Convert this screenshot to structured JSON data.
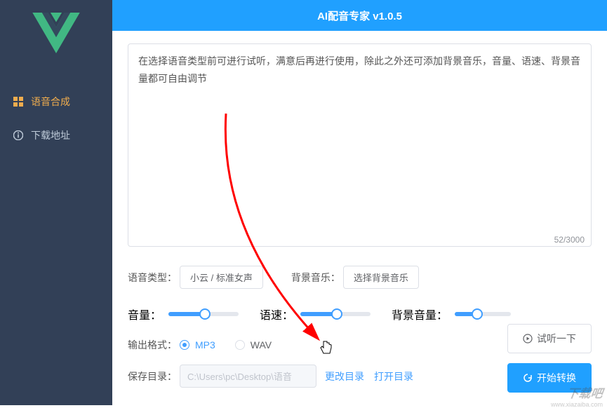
{
  "app": {
    "title": "AI配音专家 v1.0.5"
  },
  "sidebar": {
    "items": [
      {
        "label": "语音合成"
      },
      {
        "label": "下载地址"
      }
    ]
  },
  "textarea": {
    "value": "在选择语音类型前可进行试听，满意后再进行使用，除此之外还可添加背景音乐，音量、语速、背景音量都可自由调节",
    "count": "52/3000"
  },
  "voiceType": {
    "label": "语音类型：",
    "value": "小云 / 标准女声"
  },
  "bgMusic": {
    "label": "背景音乐：",
    "value": "选择背景音乐"
  },
  "sliders": {
    "volume": {
      "label": "音量：",
      "pct": 52
    },
    "speed": {
      "label": "语速：",
      "pct": 52
    },
    "bgVolume": {
      "label": "背景音量：",
      "pct": 40
    }
  },
  "format": {
    "label": "输出格式：",
    "mp3": "MP3",
    "wav": "WAV"
  },
  "path": {
    "label": "保存目录：",
    "value": "C:\\Users\\pc\\Desktop\\语音",
    "change": "更改目录",
    "open": "打开目录"
  },
  "actions": {
    "preview": "试听一下",
    "start": "开始转换"
  },
  "watermark": {
    "main": "下载吧",
    "sub": "www.xiazaiba.com"
  }
}
